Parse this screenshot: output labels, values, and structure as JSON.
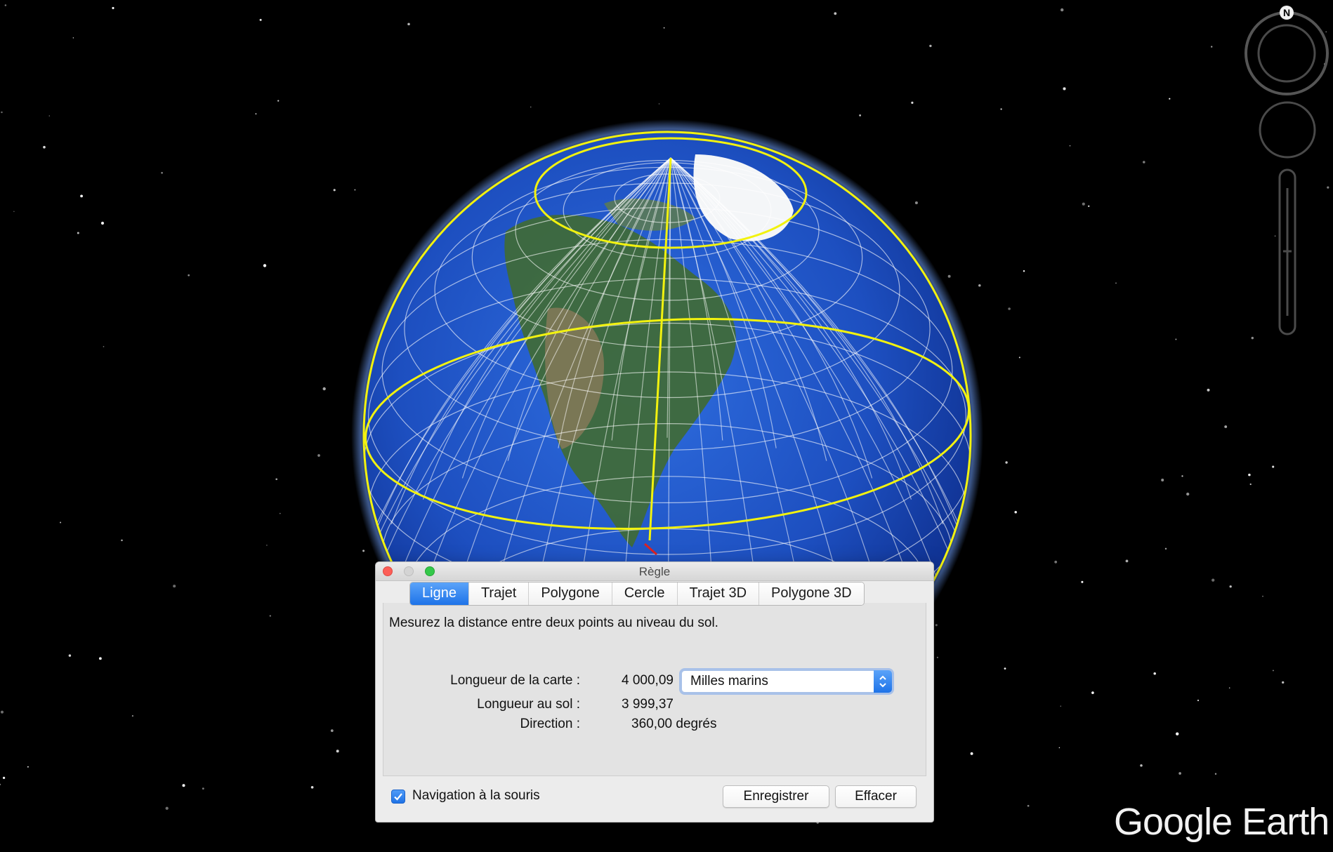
{
  "scene": {
    "compass_label": "N",
    "colors": {
      "ocean": "#1f55c8",
      "grid": "#ffffff",
      "highlight_lines": "#f2f20f",
      "atmosphere": "#6ea0ff"
    }
  },
  "logo": {
    "google": "Google",
    "earth": "Earth"
  },
  "ruler": {
    "title": "Règle",
    "tabs": [
      {
        "label": "Ligne",
        "active": true
      },
      {
        "label": "Trajet",
        "active": false
      },
      {
        "label": "Polygone",
        "active": false
      },
      {
        "label": "Cercle",
        "active": false
      },
      {
        "label": "Trajet 3D",
        "active": false
      },
      {
        "label": "Polygone 3D",
        "active": false
      }
    ],
    "description": "Mesurez la distance entre deux points au niveau du sol.",
    "map_length_label": "Longueur de la carte :",
    "map_length_value": "4 000,09",
    "ground_length_label": "Longueur au sol :",
    "ground_length_value": "3 999,37",
    "direction_label": "Direction :",
    "direction_value": "360,00 degrés",
    "unit": "Milles marins",
    "mouse_nav_label": "Navigation à la souris",
    "mouse_nav_checked": true,
    "save_label": "Enregistrer",
    "clear_label": "Effacer",
    "accent": "#1e73e8"
  }
}
